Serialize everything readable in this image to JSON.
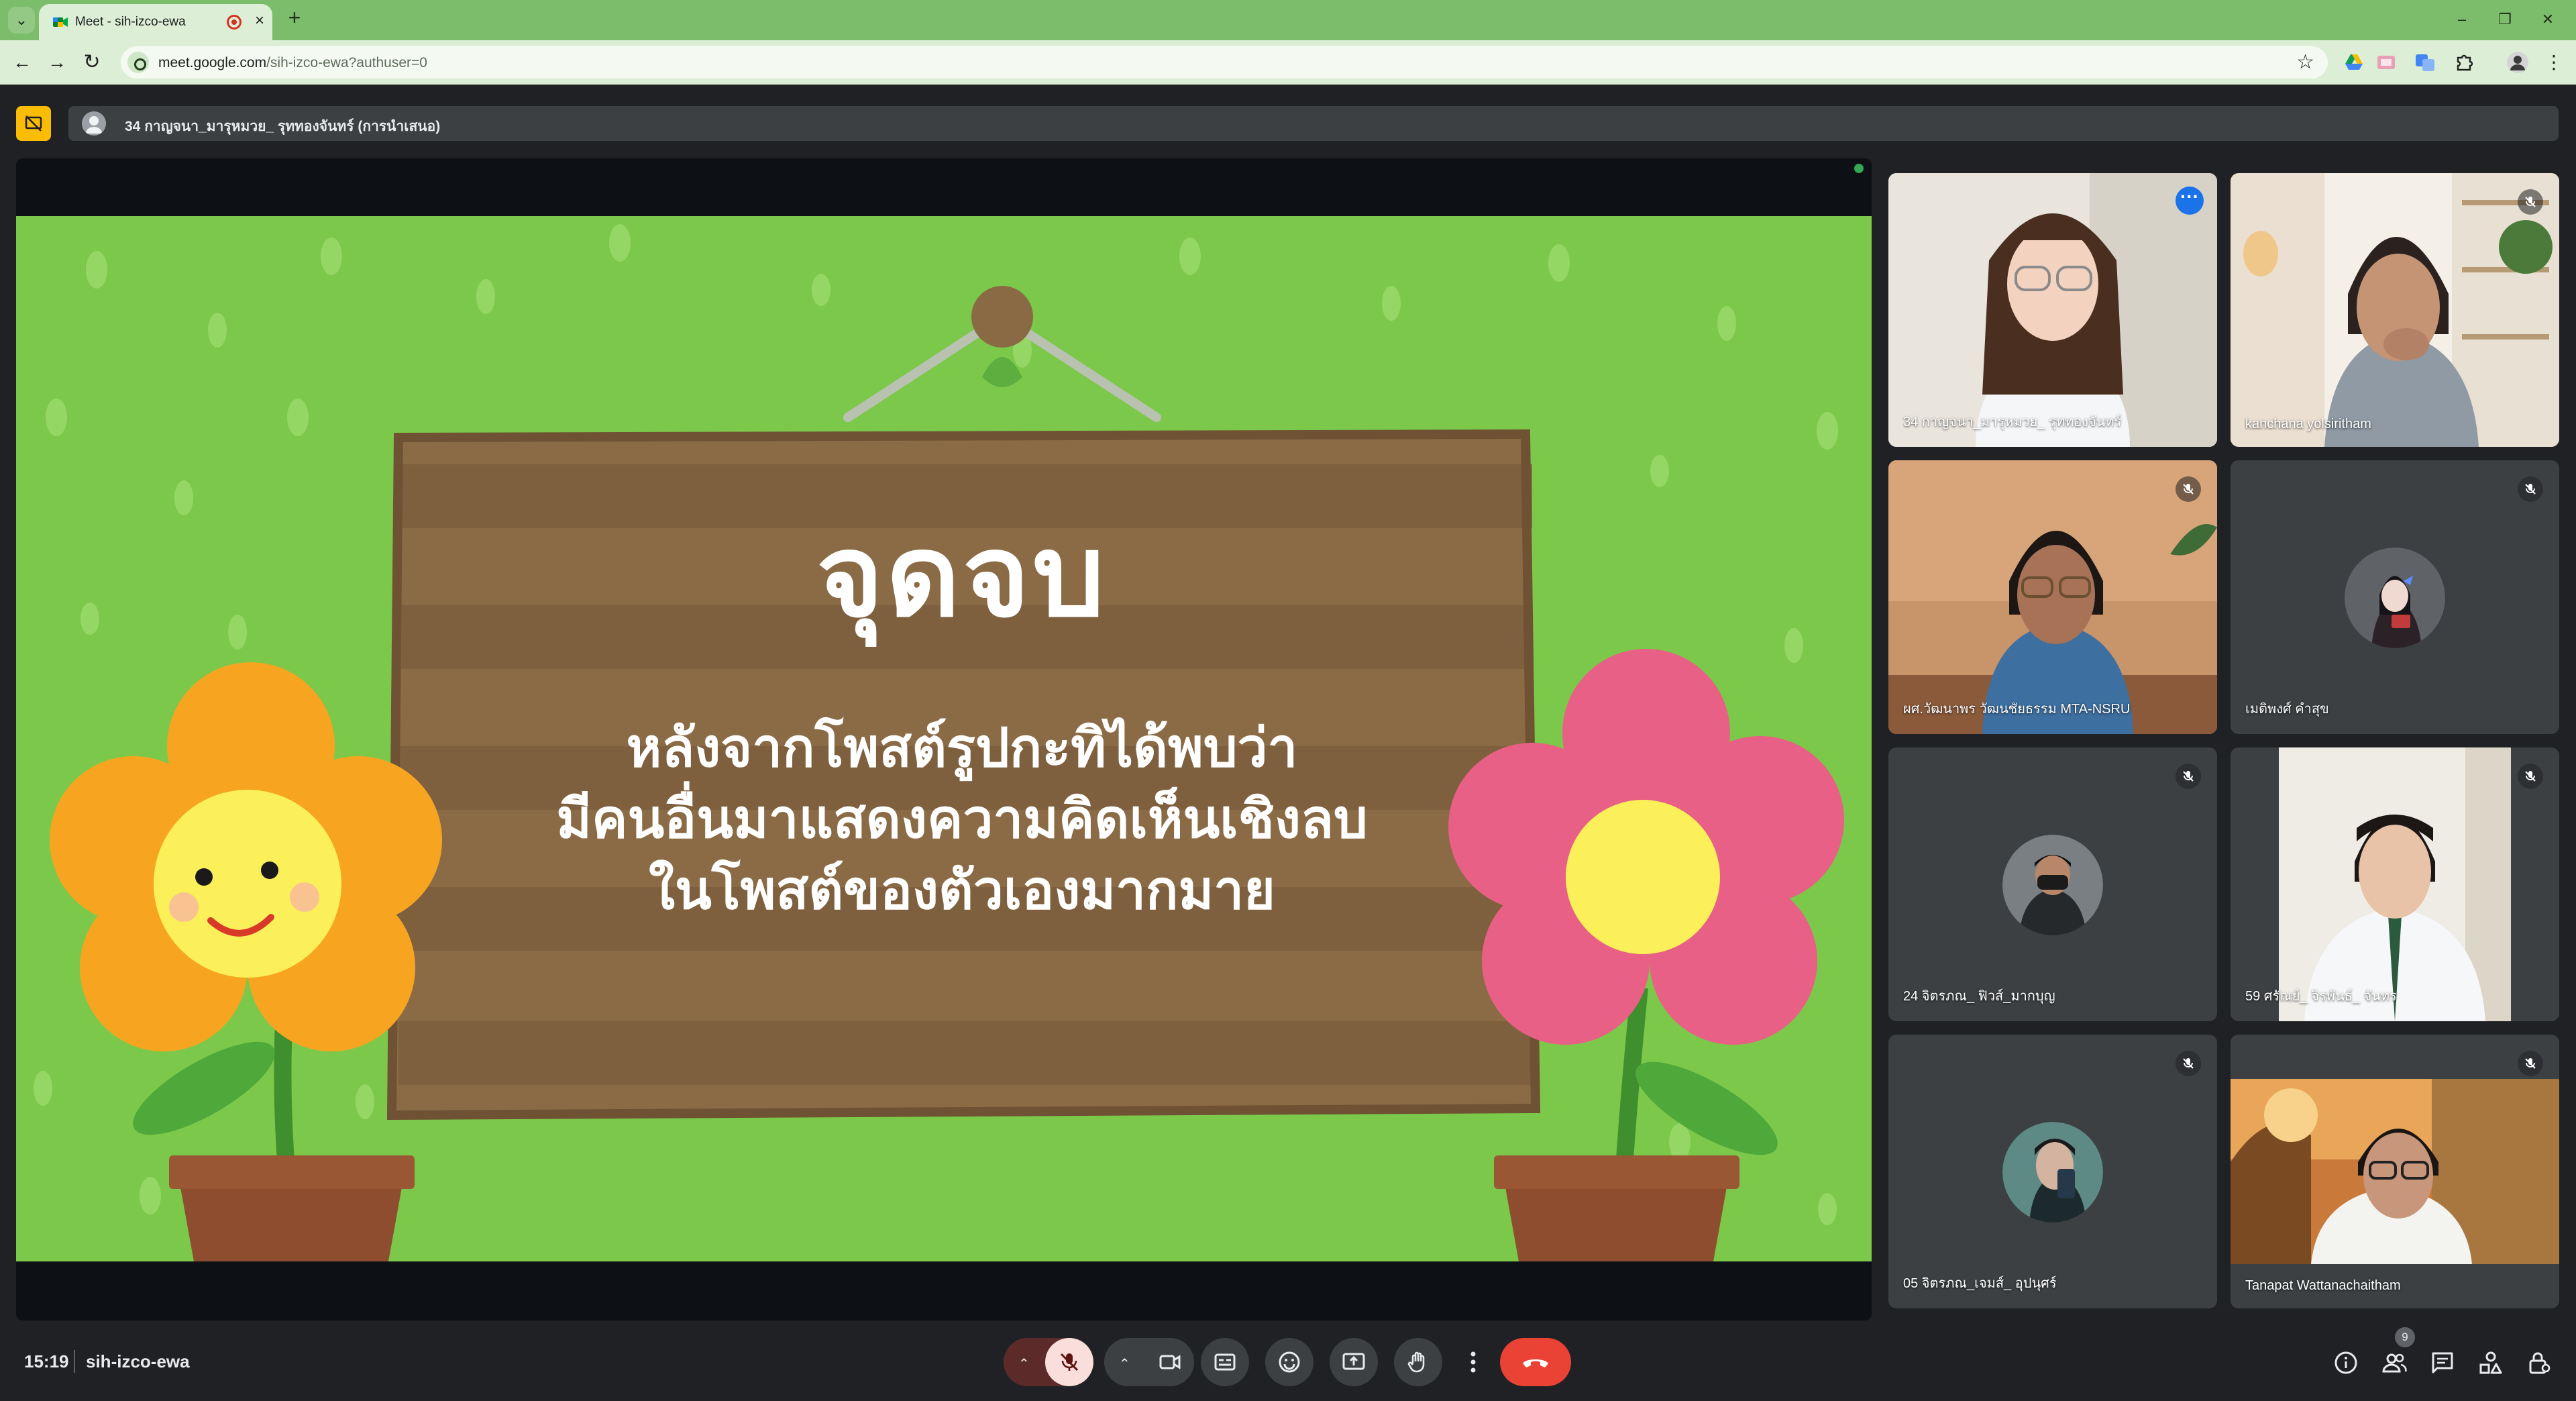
{
  "browser": {
    "tab_title": "Meet - sih-izco-ewa",
    "url_host": "meet.google.com",
    "url_path": "/sih-izco-ewa?authuser=0"
  },
  "presentation": {
    "presenter_label": "34 กาญจนา_มารุหมวย_ รุททองจันทร์ (การนำเสนอ)"
  },
  "slide": {
    "heading": "จุดจบ",
    "body_lines": [
      "หลังจากโพสต์รูปกะทิได้พบว่า",
      "มีคนอื่นมาแสดงความคิดเห็นเชิงลบ",
      "ในโพสต์ของตัวเองมากมาย"
    ]
  },
  "participants": [
    {
      "name": "34 กาญจนา_มารุหมวย_ รุททองจันทร์",
      "muted": false,
      "active": true
    },
    {
      "name": "kanchana yolsiritham",
      "muted": true,
      "active": false
    },
    {
      "name": "ผศ.วัฒนาพร วัฒนชัยธรรม MTA-NSRU",
      "muted": true,
      "active": false
    },
    {
      "name": "เมติพงศ์ คำสุข",
      "muted": true,
      "active": false
    },
    {
      "name": "24 จิตรภณ_ ฟิวส์_มากบุญ",
      "muted": true,
      "active": false
    },
    {
      "name": "59 ศรัณย์_ จิรพันธ์_ จันทร",
      "muted": true,
      "active": false
    },
    {
      "name": "05 จิตรภณ_เจมส์_ อุปนุศร์",
      "muted": true,
      "active": false
    },
    {
      "name": "Tanapat Wattanachaitham",
      "muted": true,
      "active": false
    }
  ],
  "meeting": {
    "time": "15:19",
    "code": "sih-izco-ewa",
    "participant_count": "9"
  },
  "colors": {
    "end_call": "#ea4335",
    "mic_off": "#f9dedc",
    "active_outline": "#8ab4f8",
    "tab_strip": "#7cbd6b"
  }
}
